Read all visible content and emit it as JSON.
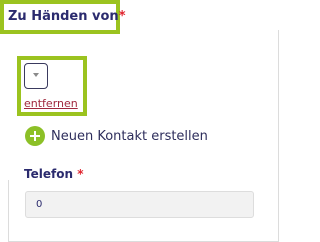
{
  "field": {
    "title": "Zu Händen von",
    "required_mark": "*"
  },
  "contact_select": {
    "value": "",
    "remove_label": "entfernen"
  },
  "new_contact": {
    "label": "Neuen Kontakt erstellen",
    "icon": "plus-circle-icon"
  },
  "phone": {
    "label": "Telefon",
    "required_mark": "*",
    "value": "0"
  },
  "colors": {
    "highlight": "#9bc31f",
    "heading": "#2b2b6e",
    "required": "#e0242e",
    "link": "#a0283e",
    "add_icon": "#8cc027"
  }
}
